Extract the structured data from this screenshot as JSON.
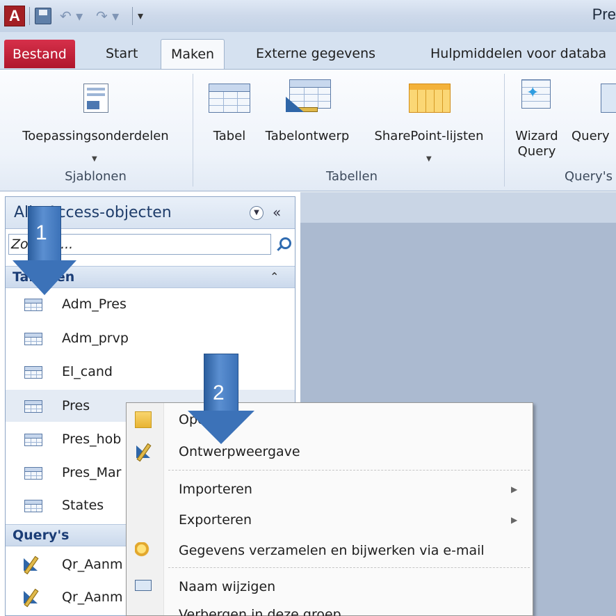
{
  "titlebar": {
    "app_icon_letter": "A",
    "title": "Pre"
  },
  "tabs": [
    {
      "label": "Bestand"
    },
    {
      "label": "Start"
    },
    {
      "label": "Maken"
    },
    {
      "label": "Externe gegevens"
    },
    {
      "label": "Hulpmiddelen voor databa"
    }
  ],
  "ribbon": {
    "groups": [
      {
        "label": "Sjablonen"
      },
      {
        "label": "Tabellen"
      },
      {
        "label": "Query's"
      }
    ],
    "buttons": {
      "toepassing": "Toepassingsonderdelen",
      "tabel": "Tabel",
      "tabelontwerp": "Tabelontwerp",
      "sharepoint": "SharePoint-lijsten",
      "wizard_line1": "Wizard",
      "wizard_line2": "Query",
      "queryontwerp": "Query"
    }
  },
  "nav": {
    "title": "Alle Access-objecten",
    "search_placeholder": "Zoeken...",
    "groups": [
      {
        "label": "Tabellen"
      },
      {
        "label": "Query's"
      }
    ],
    "tables": [
      "Adm_Pres",
      "Adm_prvp",
      "El_cand",
      "Pres",
      "Pres_hob",
      "Pres_Mar",
      "States"
    ],
    "queries": [
      "Qr_Aanm",
      "Qr_Aanm"
    ]
  },
  "context_menu": {
    "items": [
      {
        "label": "Openen"
      },
      {
        "label": "Ontwerpweergave"
      },
      {
        "label": "Importeren"
      },
      {
        "label": "Exporteren"
      },
      {
        "label": "Gegevens verzamelen en bijwerken via e-mail"
      },
      {
        "label": "Naam wijzigen"
      },
      {
        "label": "Verbergen in deze groep"
      }
    ]
  },
  "annotations": {
    "arrow1": "1",
    "arrow2": "2"
  },
  "colors": {
    "file_tab": "#c3213a",
    "arrow": "#3c72b8",
    "nav_group_text": "#1b3d76"
  }
}
